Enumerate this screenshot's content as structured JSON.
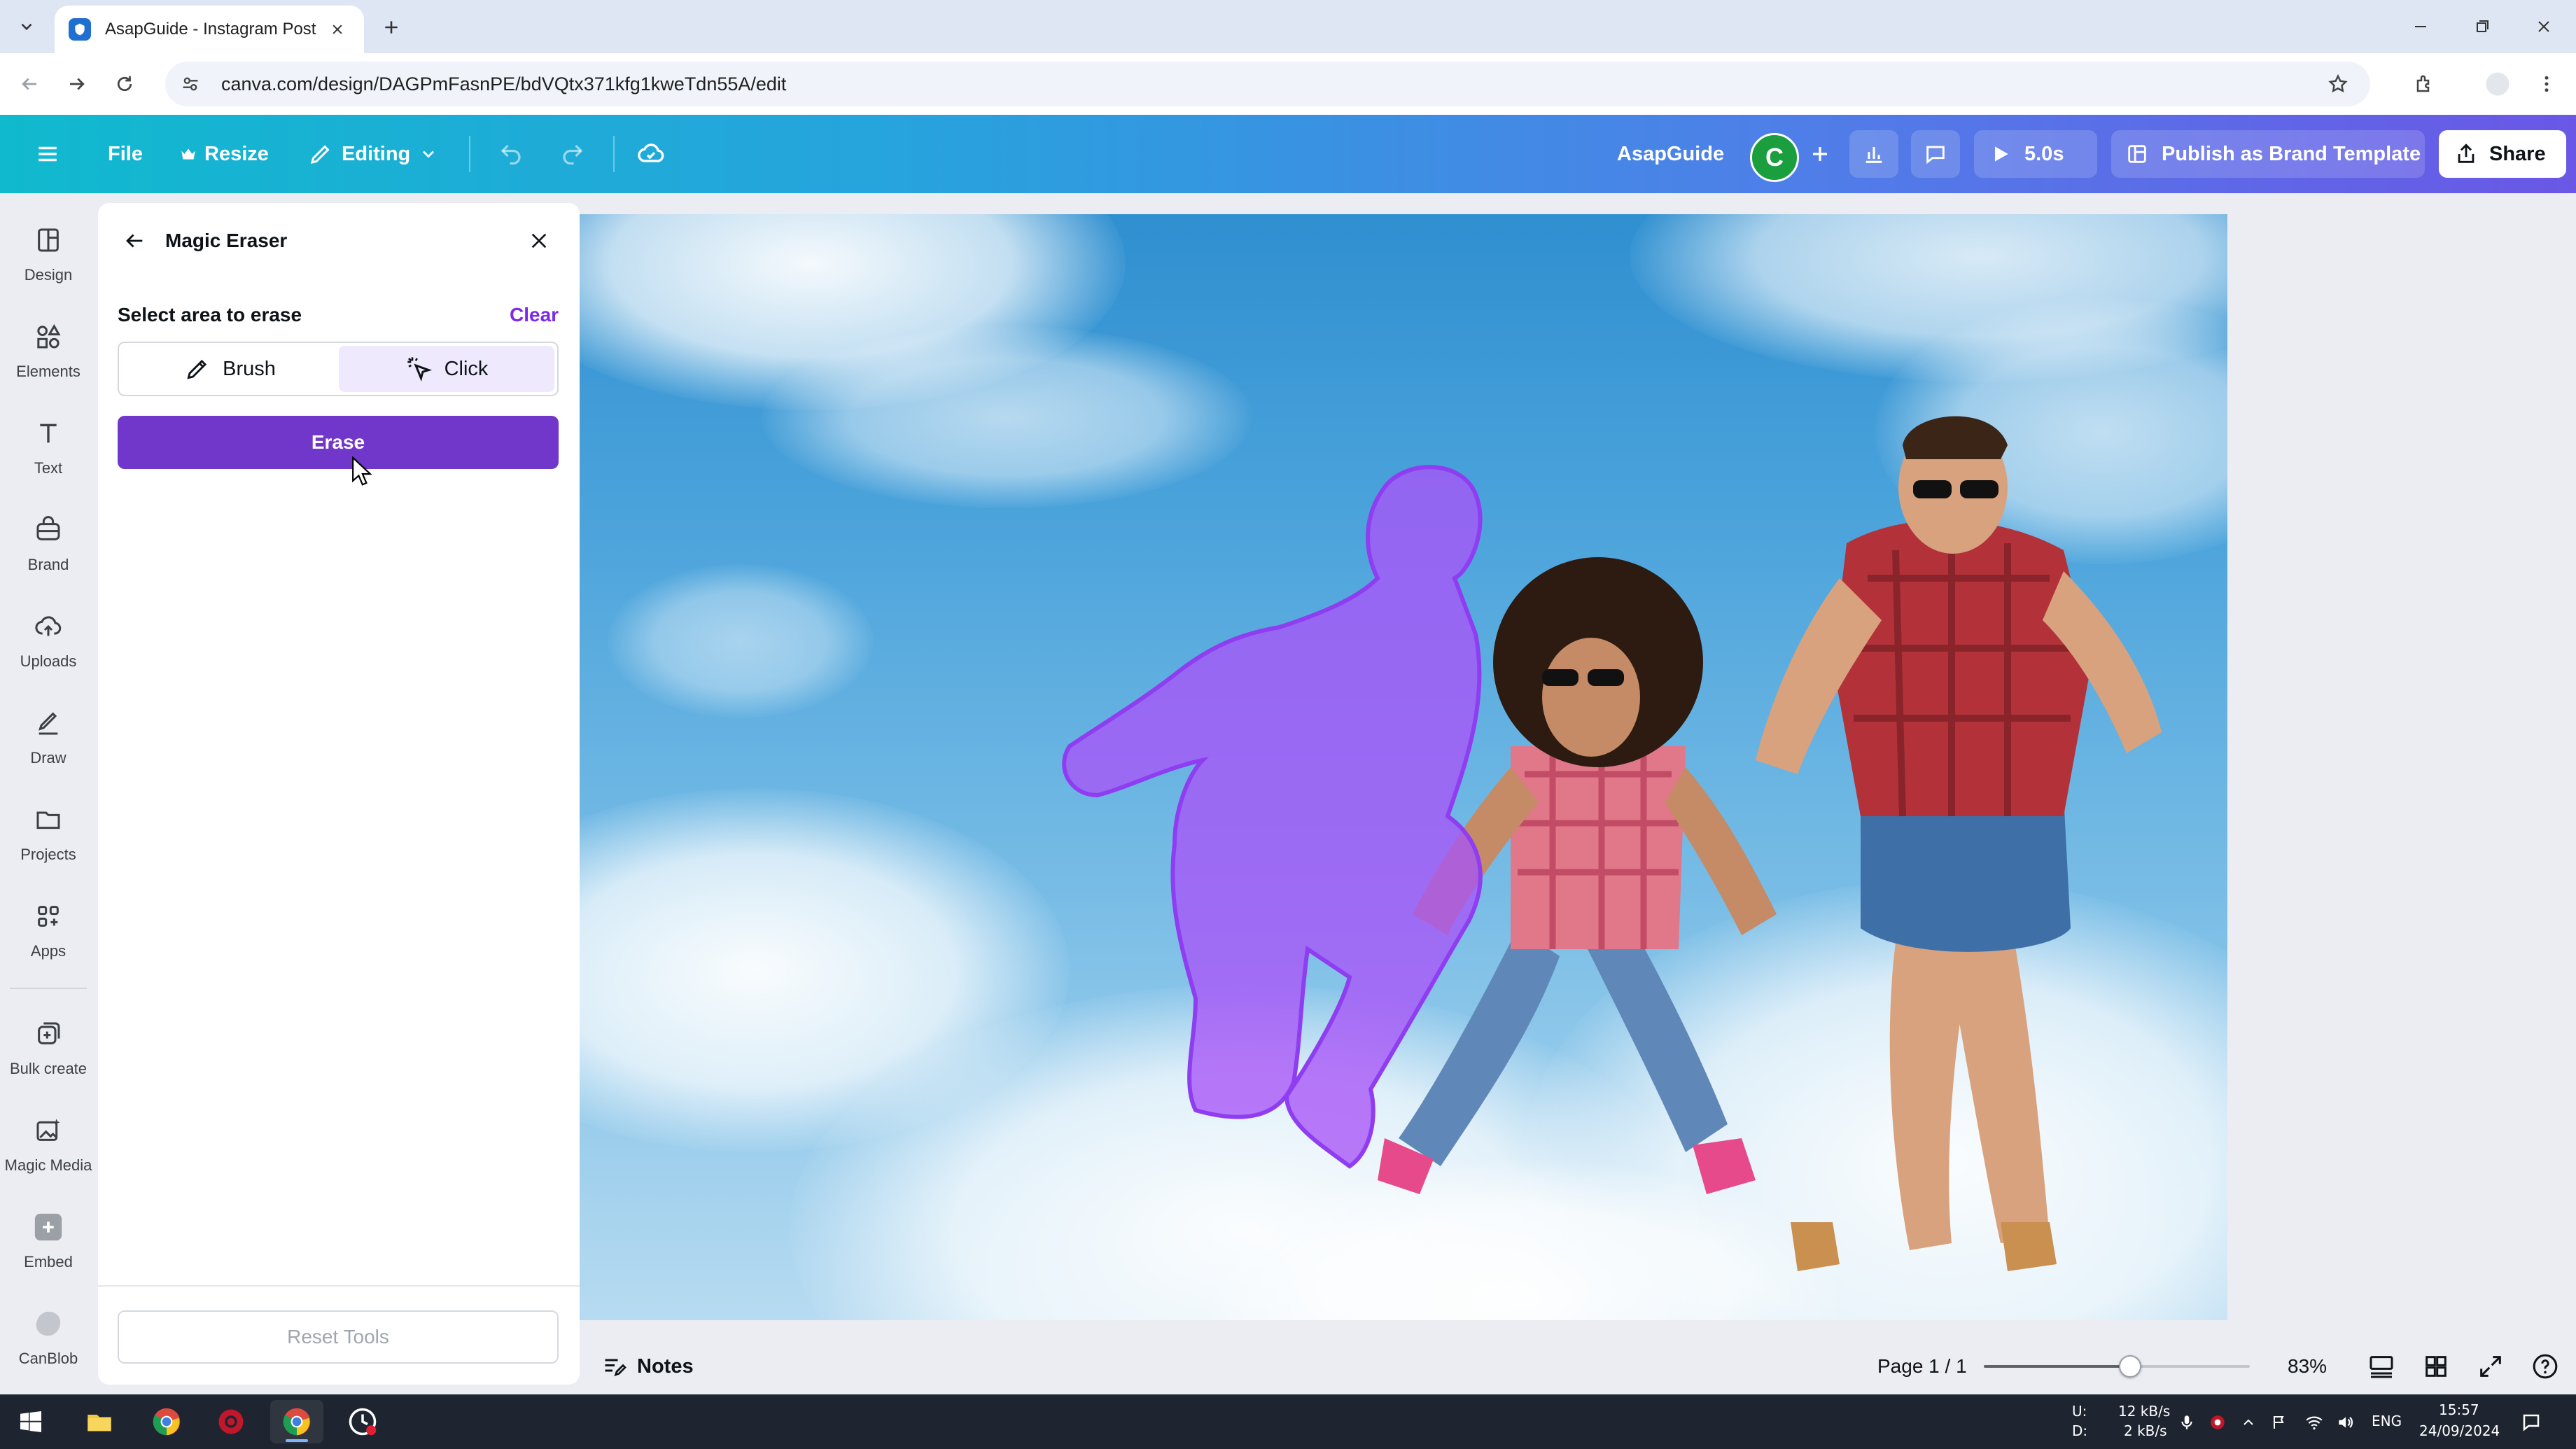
{
  "browser": {
    "tab_title": "AsapGuide - Instagram Post",
    "url": "canva.com/design/DAGPmFasnPE/bdVQtx371kfg1kweTdn55A/edit"
  },
  "header": {
    "file_label": "File",
    "resize_label": "Resize",
    "editing_label": "Editing",
    "team_name": "AsapGuide",
    "avatar_initial": "C",
    "play_duration": "5.0s",
    "publish_label": "Publish as Brand Template",
    "share_label": "Share"
  },
  "rail": {
    "items": [
      {
        "label": "Design"
      },
      {
        "label": "Elements"
      },
      {
        "label": "Text"
      },
      {
        "label": "Brand"
      },
      {
        "label": "Uploads"
      },
      {
        "label": "Draw"
      },
      {
        "label": "Projects"
      },
      {
        "label": "Apps"
      },
      {
        "label": "Bulk create"
      },
      {
        "label": "Magic Media"
      },
      {
        "label": "Embed"
      },
      {
        "label": "CanBlob"
      }
    ]
  },
  "panel": {
    "title": "Magic Eraser",
    "select_label": "Select area to erase",
    "clear_label": "Clear",
    "brush_label": "Brush",
    "click_label": "Click",
    "active_mode": "Click",
    "erase_label": "Erase",
    "reset_label": "Reset Tools"
  },
  "bottombar": {
    "notes_label": "Notes",
    "page_indicator": "Page 1 / 1",
    "zoom_label": "83%",
    "zoom_fraction": 0.55
  },
  "taskbar": {
    "net_up_label": "U:",
    "net_down_label": "D:",
    "net_up": "12 kB/s",
    "net_down": "2 kB/s",
    "lang": "ENG",
    "time": "15:57",
    "date": "24/09/2024"
  },
  "colors": {
    "accent_purple": "#7037ca",
    "link_purple": "#7d2ae8",
    "selection_overlay": "#a855f7",
    "header_gradient_start": "#10b9ce",
    "header_gradient_end": "#6a57e6"
  }
}
